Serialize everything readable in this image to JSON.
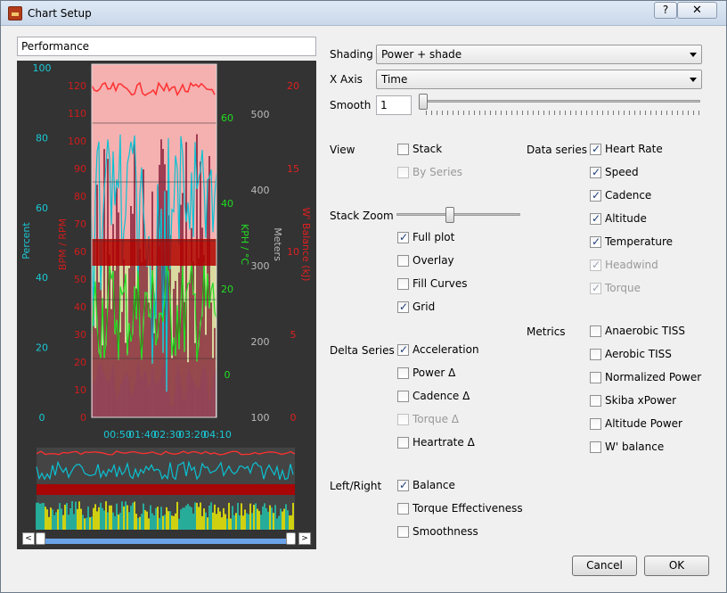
{
  "window": {
    "title": "Chart Setup",
    "help": "?",
    "close": "✕"
  },
  "chart_name": "Performance",
  "preview": {
    "axes": {
      "percent": {
        "label": "Percent",
        "ticks": [
          "100",
          "80",
          "60",
          "40",
          "20",
          "0"
        ]
      },
      "bpm": {
        "label": "BPM / RPM",
        "ticks": [
          "120",
          "110",
          "100",
          "90",
          "80",
          "70",
          "60",
          "50",
          "40",
          "30",
          "20",
          "10",
          "0"
        ]
      },
      "kph": {
        "label": "KPH / °C",
        "ticks": [
          "60",
          "40",
          "20",
          "0"
        ]
      },
      "meters": {
        "label": "Meters",
        "ticks": [
          "500",
          "400",
          "300",
          "200",
          "100"
        ]
      },
      "wbal": {
        "label": "W' Balance (kJ)",
        "ticks": [
          "20",
          "15",
          "10",
          "5",
          "0"
        ]
      },
      "time": {
        "ticks": [
          "00:50",
          "01:40",
          "02:30",
          "03:20",
          "04:10"
        ]
      }
    },
    "scroll_left": "<",
    "scroll_right": ">",
    "colors": {
      "heartrate": "#b30000",
      "cadence": "#0ac2d3",
      "power": "#7a0c2a",
      "speed": "#22dd22",
      "altitude": "#c8c8c8",
      "wbal": "#ff3030",
      "acc": "#ffff00"
    }
  },
  "shading": {
    "label": "Shading",
    "value": "Power + shade"
  },
  "xaxis": {
    "label": "X Axis",
    "value": "Time"
  },
  "smooth": {
    "label": "Smooth",
    "value": "1",
    "slider_level": 0
  },
  "view": {
    "label": "View",
    "stack": "Stack",
    "by_series": "By Series"
  },
  "stack_zoom": {
    "label": "Stack Zoom",
    "slider_level": 0.4
  },
  "display": {
    "full_plot": "Full plot",
    "overlay": "Overlay",
    "fill_curves": "Fill Curves",
    "grid": "Grid"
  },
  "delta": {
    "label": "Delta Series",
    "acceleration": "Acceleration",
    "power": "Power Δ",
    "cadence": "Cadence Δ",
    "torque": "Torque Δ",
    "heartrate": "Heartrate Δ"
  },
  "leftright": {
    "label": "Left/Right",
    "balance": "Balance",
    "torque_eff": "Torque Effectiveness",
    "smoothness": "Smoothness"
  },
  "data_series": {
    "label": "Data series",
    "heart_rate": "Heart Rate",
    "speed": "Speed",
    "cadence": "Cadence",
    "altitude": "Altitude",
    "temperature": "Temperature",
    "headwind": "Headwind",
    "torque": "Torque"
  },
  "metrics": {
    "label": "Metrics",
    "anaerobic": "Anaerobic TISS",
    "aerobic": "Aerobic TISS",
    "normalized": "Normalized Power",
    "skiba": "Skiba xPower",
    "altitude_power": "Altitude Power",
    "wbalance": "W' balance"
  },
  "buttons": {
    "cancel": "Cancel",
    "ok": "OK"
  }
}
